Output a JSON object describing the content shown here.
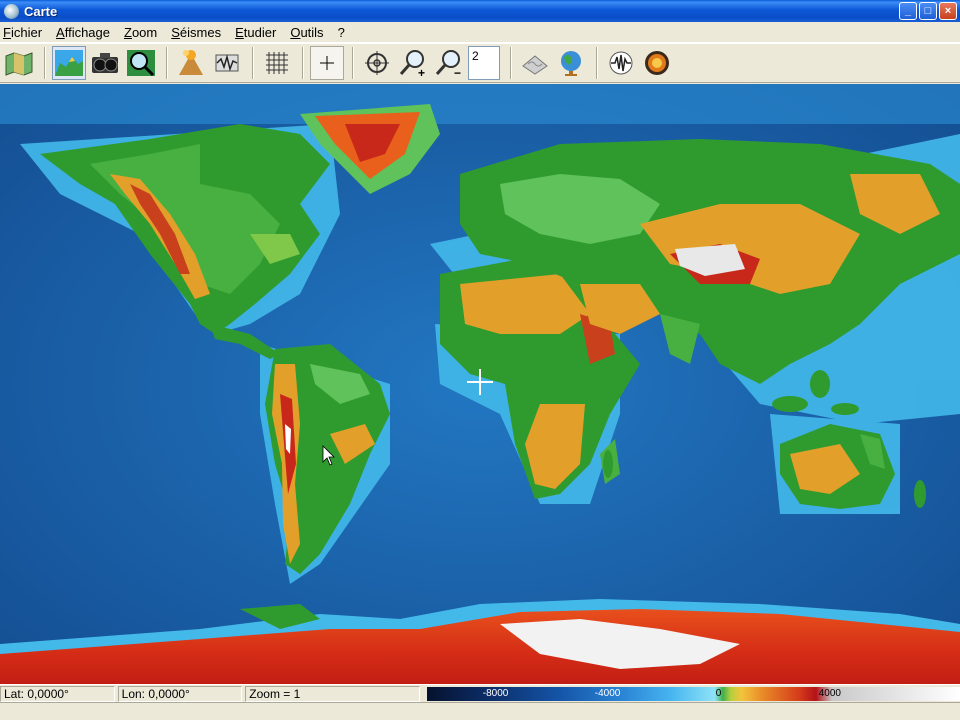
{
  "window": {
    "title": "Carte",
    "minimize": "_",
    "maximize": "□",
    "close": "×"
  },
  "menu": [
    "Fichier",
    "Affichage",
    "Zoom",
    "Séismes",
    "Etudier",
    "Outils",
    "?"
  ],
  "menu_underline": [
    "F",
    "A",
    "Z",
    "S",
    "E",
    "O",
    ""
  ],
  "toolbar": {
    "icons": [
      "map-icon",
      "terrain-view-icon",
      "camera-icon",
      "magnifier-icon",
      "volcano-icon",
      "seismograph-icon",
      "grid-icon",
      "crosshair-icon",
      "target-icon",
      "zoom-in-icon",
      "zoom-out-icon",
      "wave-icon",
      "globe-icon",
      "seismic-wave-icon",
      "earth-core-icon"
    ],
    "zoom_value": "2"
  },
  "status": {
    "lat": "Lat: 0,0000°",
    "lon": "Lon: 0,0000°",
    "zoom": "Zoom = 1",
    "scale_labels": [
      "-8000",
      "-4000",
      "0",
      "4000"
    ]
  },
  "colors": {
    "ocean_deep": "#0e3f86",
    "ocean_shallow": "#3fb7ea",
    "lowland": "#2e9a2c",
    "highland": "#e3a02a",
    "mountain": "#c8281a",
    "ice": "#ffffff"
  }
}
